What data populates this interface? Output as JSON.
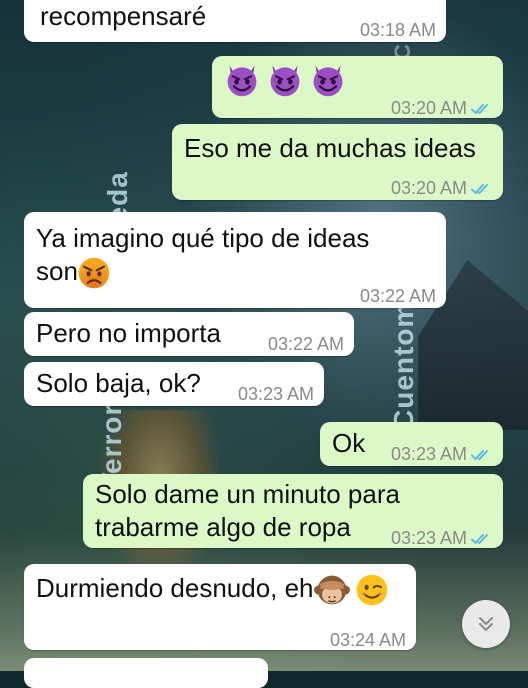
{
  "watermarks": [
    "lleda",
    "Terror",
    "Cuentom",
    "Cuentom"
  ],
  "messages": [
    {
      "dir": "in",
      "text": "recompensaré",
      "time": "03:18 AM"
    },
    {
      "dir": "out",
      "text": "",
      "emoji": [
        "smiling-imp-emoji",
        "smiling-imp-emoji",
        "smiling-imp-emoji"
      ],
      "time": "03:20 AM",
      "read": true
    },
    {
      "dir": "out",
      "text": "Eso me da muchas ideas",
      "time": "03:20 AM",
      "read": true
    },
    {
      "dir": "in",
      "line1": "Ya imagino qué tipo de ideas",
      "line2": "son",
      "emoji": [
        "angry-face-emoji"
      ],
      "time": "03:22 AM"
    },
    {
      "dir": "in",
      "text": "Pero no importa",
      "time": "03:22 AM"
    },
    {
      "dir": "in",
      "text": "Solo baja, ok?",
      "time": "03:23 AM"
    },
    {
      "dir": "out",
      "text": "Ok",
      "time": "03:23 AM",
      "read": true
    },
    {
      "dir": "out",
      "line1": "Solo dame un minuto para",
      "line2": "trabarme algo de ropa",
      "time": "03:23 AM",
      "read": true
    },
    {
      "dir": "in",
      "text": "Durmiendo desnudo, eh",
      "emoji": [
        "see-no-evil-monkey-emoji",
        "winking-face-emoji"
      ],
      "time": "03:24 AM"
    }
  ],
  "colors": {
    "incoming_bubble": "#ffffff",
    "outgoing_bubble": "#dcf8c6",
    "read_tick": "#4fb6ec",
    "timestamp": "#8a8a8a"
  },
  "scroll_button_icon": "double-chevron-down-icon"
}
